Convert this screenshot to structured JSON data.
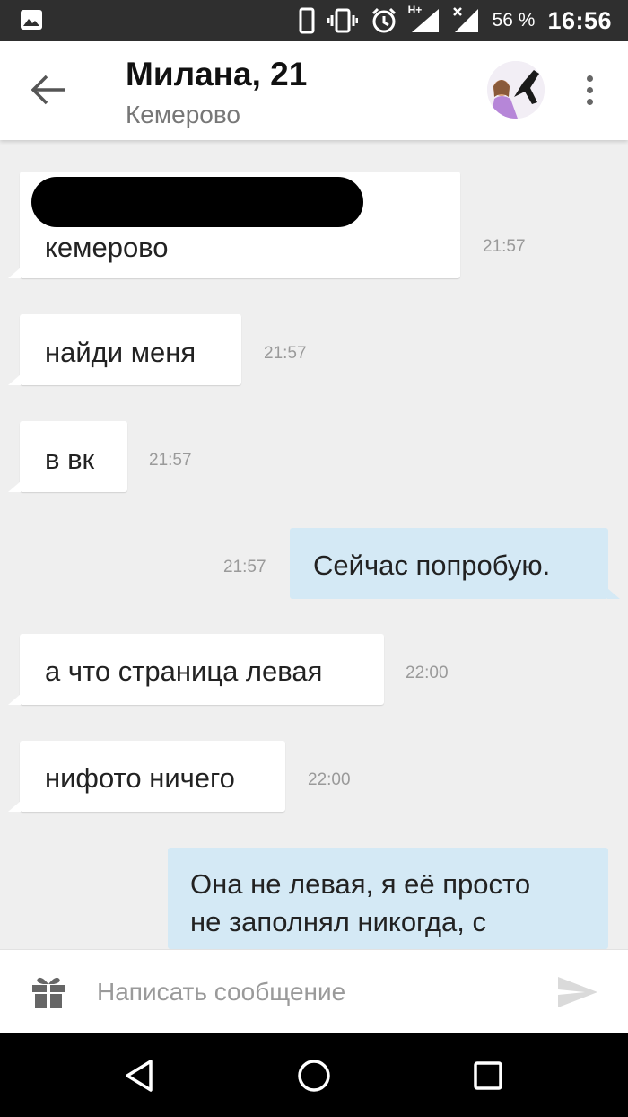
{
  "status_bar": {
    "battery": "56 %",
    "time": "16:56",
    "network_label": "H+",
    "icons": [
      "image-icon",
      "phone-icon",
      "vibrate-icon",
      "alarm-icon",
      "signal-icon",
      "signal-no-data-icon"
    ]
  },
  "header": {
    "name": "Милана, 21",
    "city": "Кемерово",
    "back_icon": "arrow-left-icon",
    "menu_icon": "more-vert-icon"
  },
  "messages": [
    {
      "direction": "in",
      "text": "кемерово",
      "time": "21:57",
      "redacted_line_above": true
    },
    {
      "direction": "in",
      "text": "найди меня",
      "time": "21:57"
    },
    {
      "direction": "in",
      "text": "в вк",
      "time": "21:57"
    },
    {
      "direction": "out",
      "text": "Сейчас попробую.",
      "time": "21:57"
    },
    {
      "direction": "in",
      "text": "а что страница левая",
      "time": "22:00"
    },
    {
      "direction": "in",
      "text": "нифото ничего",
      "time": "22:00"
    },
    {
      "direction": "out",
      "lines": [
        "Она не левая, я её просто",
        "не заполнял никогда, с"
      ]
    }
  ],
  "composer": {
    "placeholder": "Написать сообщение",
    "value": "",
    "gift_icon": "gift-icon",
    "send_icon": "send-icon"
  },
  "nav": {
    "icons": [
      "back-triangle-icon",
      "home-circle-icon",
      "recents-square-icon"
    ]
  },
  "colors": {
    "incoming_bubble": "#ffffff",
    "outgoing_bubble": "#d4e9f5",
    "chat_background": "#efefef"
  }
}
